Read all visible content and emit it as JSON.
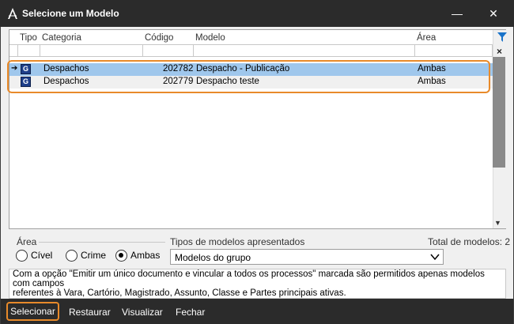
{
  "window": {
    "title": "Selecione um Modelo",
    "minimize": "—",
    "close": "✕"
  },
  "grid": {
    "headers": [
      "Tipo",
      "Categoria",
      "Código",
      "Modelo",
      "Área"
    ],
    "rows": [
      {
        "tipo": "G",
        "categoria": "Despachos",
        "codigo": "202782",
        "modelo": "Despacho - Publicação",
        "area": "Ambas",
        "selected": true
      },
      {
        "tipo": "G",
        "categoria": "Despachos",
        "codigo": "202779",
        "modelo": "Despacho teste",
        "area": "Ambas",
        "selected": false
      }
    ],
    "clear_filter": "×"
  },
  "area": {
    "legend": "Área",
    "options": [
      "Cível",
      "Crime",
      "Ambas"
    ],
    "selected": "Ambas"
  },
  "tipos": {
    "label": "Tipos de modelos apresentados",
    "selected": "Modelos do grupo"
  },
  "total": "Total de modelos: 2",
  "info": {
    "line1": "Com a opção \"Emitir um único documento e vincular a todos os processos\" marcada são permitidos apenas modelos com campos",
    "line2": "referentes à Vara, Cartório, Magistrado, Assunto, Classe e Partes principais ativas."
  },
  "toolbar": {
    "select": "Selecionar",
    "restore": "Restaurar",
    "view": "Visualizar",
    "close": "Fechar"
  },
  "colors": {
    "accent": "#e88a2a",
    "selection": "#9fc7ec",
    "titlebar": "#2b2b2b"
  }
}
